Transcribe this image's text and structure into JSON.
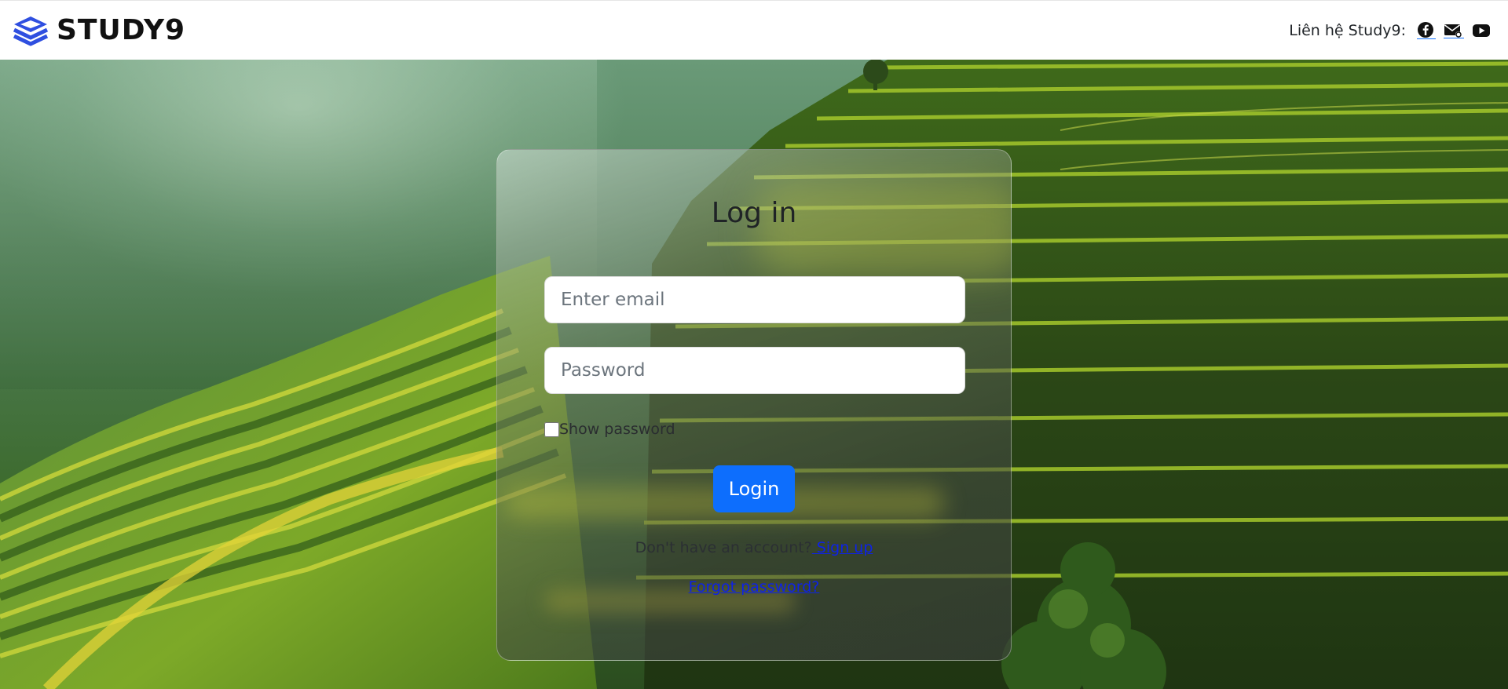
{
  "header": {
    "brand": "STUDY9",
    "contact_label": "Liên hệ Study9:",
    "social": [
      {
        "name": "facebook-icon"
      },
      {
        "name": "mail-icon"
      },
      {
        "name": "youtube-icon"
      }
    ]
  },
  "login": {
    "title": "Log in",
    "email_placeholder": "Enter email",
    "password_placeholder": "Password",
    "show_password_label": "Show password",
    "show_password_checked": false,
    "login_button": "Login",
    "no_account_text": "Don't have an account?",
    "signup_link": " Sign up",
    "forgot_link": "Forgot password?"
  },
  "colors": {
    "brand_blue": "#2f4fe0",
    "button_primary": "#0d6efd",
    "link": "#0d22e6",
    "header_bg": "#ffffff"
  }
}
